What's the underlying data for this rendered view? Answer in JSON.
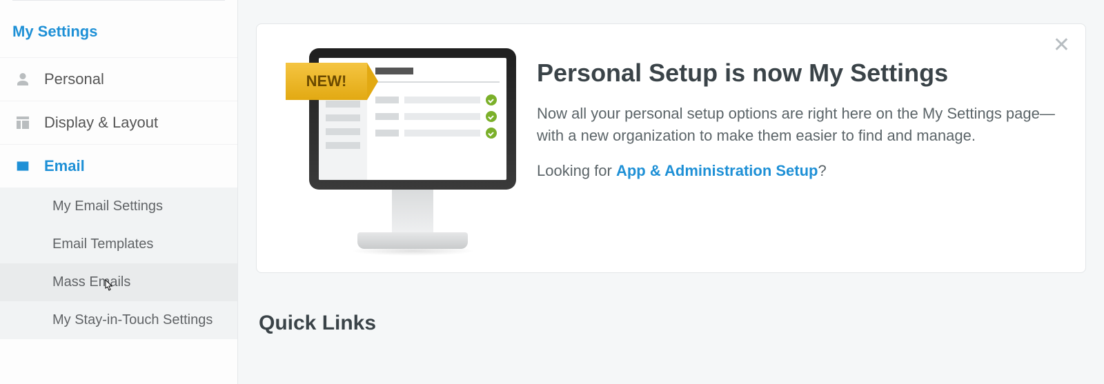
{
  "sidebar": {
    "header": "My Settings",
    "items": {
      "personal": "Personal",
      "display": "Display & Layout",
      "email": "Email"
    },
    "email_sub": {
      "my_email_settings": "My Email Settings",
      "email_templates": "Email Templates",
      "mass_emails": "Mass Emails",
      "stay_in_touch": "My Stay-in-Touch Settings"
    }
  },
  "banner": {
    "badge": "NEW!",
    "title": "Personal Setup is now My Settings",
    "desc": "Now all your personal setup options are right here on the My Settings page—with a new organization to make them easier to find and manage.",
    "looking_prefix": "Looking for ",
    "link": "App & Administration Setup",
    "looking_suffix": "?"
  },
  "quicklinks": {
    "title": "Quick Links"
  }
}
